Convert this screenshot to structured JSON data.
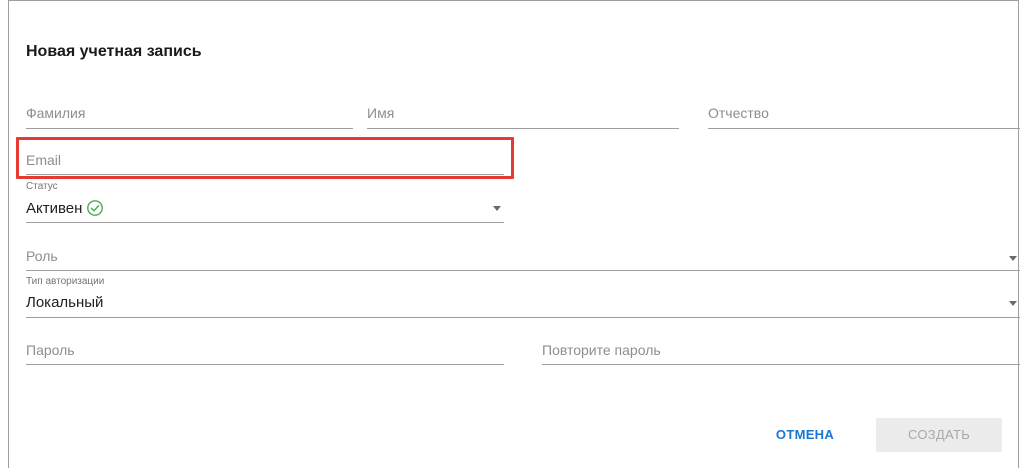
{
  "dialog": {
    "title": "Новая учетная запись",
    "fields": {
      "last_name": {
        "placeholder": "Фамилия",
        "value": ""
      },
      "first_name": {
        "placeholder": "Имя",
        "value": ""
      },
      "middle_name": {
        "placeholder": "Отчество",
        "value": ""
      },
      "email": {
        "placeholder": "Email",
        "value": ""
      },
      "status": {
        "label": "Статус",
        "value": "Активен",
        "icon": "check-circle-icon"
      },
      "role": {
        "placeholder": "Роль",
        "value": ""
      },
      "auth_type": {
        "label": "Тип авторизации",
        "value": "Локальный"
      },
      "password": {
        "placeholder": "Пароль",
        "value": ""
      },
      "password_repeat": {
        "placeholder": "Повторите пароль",
        "value": ""
      }
    },
    "buttons": {
      "cancel": "ОТМЕНА",
      "create": "СОЗДАТЬ"
    },
    "colors": {
      "accent": "#1976d2",
      "success": "#4caf50",
      "highlight": "#e53935"
    }
  }
}
